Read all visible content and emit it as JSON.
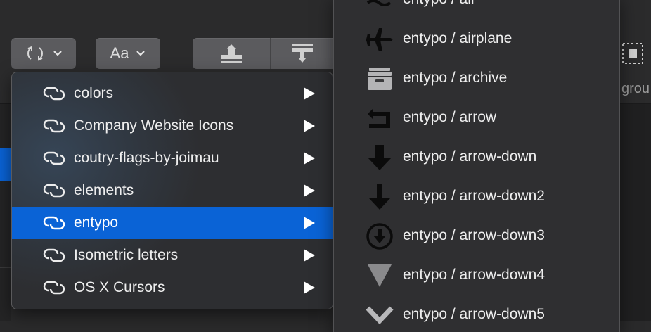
{
  "toolbar": {
    "sync_button_icon": "sync-icon",
    "font_button_label": "Aa",
    "align_buttons": [
      "align-top-icon",
      "align-bottom-icon"
    ],
    "right_partial_text": "grou"
  },
  "menu": {
    "items": [
      {
        "label": "colors",
        "icon": "link-icon",
        "selected": false
      },
      {
        "label": "Company Website Icons",
        "icon": "link-icon",
        "selected": false
      },
      {
        "label": "coutry-flags-by-joimau",
        "icon": "link-icon",
        "selected": false
      },
      {
        "label": "elements",
        "icon": "link-icon",
        "selected": false
      },
      {
        "label": "entypo",
        "icon": "link-icon",
        "selected": true
      },
      {
        "label": "Isometric letters",
        "icon": "link-icon",
        "selected": false
      },
      {
        "label": "OS X Cursors",
        "icon": "link-icon",
        "selected": false
      }
    ]
  },
  "submenu": {
    "items": [
      {
        "label": "entypo / air",
        "icon": "air-icon"
      },
      {
        "label": "entypo / airplane",
        "icon": "airplane-icon"
      },
      {
        "label": "entypo / archive",
        "icon": "archive-icon"
      },
      {
        "label": "entypo / arrow",
        "icon": "arrow-back-icon"
      },
      {
        "label": "entypo / arrow-down",
        "icon": "arrow-down-icon"
      },
      {
        "label": "entypo / arrow-down2",
        "icon": "arrow-down2-icon"
      },
      {
        "label": "entypo / arrow-down3",
        "icon": "arrow-down-circle-icon"
      },
      {
        "label": "entypo / arrow-down4",
        "icon": "triangle-down-icon"
      },
      {
        "label": "entypo / arrow-down5",
        "icon": "chevron-down-icon"
      }
    ]
  },
  "colors": {
    "selection": "#0a63d6",
    "menu_bg": "#2f2f31",
    "text": "#eeeeee"
  }
}
